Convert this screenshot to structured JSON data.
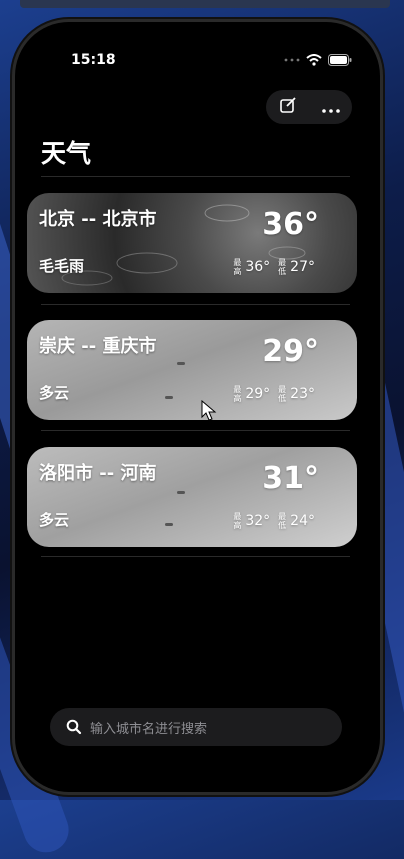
{
  "status": {
    "time": "15:18"
  },
  "header": {
    "title": "天气"
  },
  "cities": [
    {
      "name": "北京 -- 北京市",
      "temp": "36°",
      "condition": "毛毛雨",
      "high_label_a": "最",
      "high_label_b": "高",
      "high": "36°",
      "low_label_a": "最",
      "low_label_b": "低",
      "low": "27°"
    },
    {
      "name": "崇庆 -- 重庆市",
      "temp": "29°",
      "condition": "多云",
      "high_label_a": "最",
      "high_label_b": "高",
      "high": "29°",
      "low_label_a": "最",
      "low_label_b": "低",
      "low": "23°"
    },
    {
      "name": "洛阳市 -- 河南",
      "temp": "31°",
      "condition": "多云",
      "high_label_a": "最",
      "high_label_b": "高",
      "high": "32°",
      "low_label_a": "最",
      "low_label_b": "低",
      "low": "24°"
    }
  ],
  "search": {
    "placeholder": "输入城市名进行搜索"
  },
  "icons": {
    "edit": "edit-icon",
    "more": "more-icon",
    "search": "search-icon"
  }
}
